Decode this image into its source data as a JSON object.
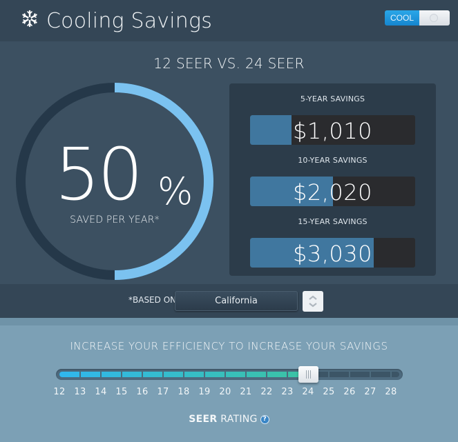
{
  "header": {
    "icon": "snowflake-icon",
    "title": "Cooling Savings",
    "mode_toggle": {
      "label": "COOL",
      "state": "on"
    }
  },
  "comparison": {
    "title": "12 SEER VS. 24 SEER",
    "base_seer": 12,
    "target_seer": 24
  },
  "gauge": {
    "value": "50",
    "unit": "%",
    "caption": "SAVED PER YEAR*",
    "fraction": 0.5,
    "colors": {
      "fill": "#7bc2f0",
      "track": "#253849"
    }
  },
  "savings": [
    {
      "label": "5-YEAR SAVINGS",
      "value": "$1,010",
      "fraction": 0.25
    },
    {
      "label": "10-YEAR SAVINGS",
      "value": "$2,020",
      "fraction": 0.5
    },
    {
      "label": "15-YEAR SAVINGS",
      "value": "$3,030",
      "fraction": 0.75
    }
  ],
  "location": {
    "label": "*BASED ON",
    "selected": "California",
    "stepper_icon": "up-down-chevron-icon"
  },
  "slider": {
    "heading": "INCREASE YOUR EFFICIENCY TO INCREASE YOUR SAVINGS",
    "ticks": [
      "12",
      "13",
      "14",
      "15",
      "16",
      "17",
      "18",
      "19",
      "20",
      "21",
      "22",
      "23",
      "24",
      "25",
      "26",
      "27",
      "28"
    ],
    "min": 12,
    "max": 28,
    "value": 24,
    "label_bold": "SEER",
    "label_rest": " RATING",
    "help_icon": "?"
  }
}
